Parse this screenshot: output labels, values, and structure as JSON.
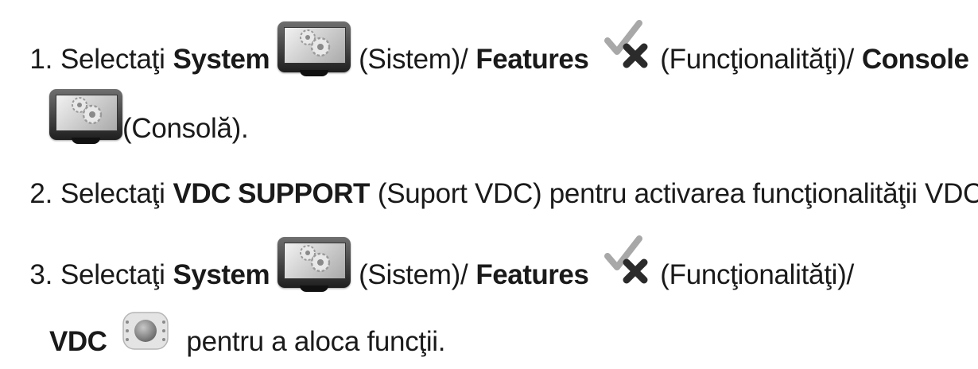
{
  "steps": [
    {
      "number": "1.",
      "select": "Selectaţi",
      "system": "System",
      "system_ro": "(Sistem)/",
      "features": "Features",
      "features_ro": "(Funcţionalităţi)/",
      "console": "Console",
      "console_ro": "(Consolă)."
    },
    {
      "number": "2.",
      "select": "Selectaţi",
      "vdc_support": "VDC SUPPORT",
      "rest": "(Suport VDC) pentru activarea funcţionalităţii VDC."
    },
    {
      "number": "3.",
      "select": "Selectaţi",
      "system": "System",
      "system_ro": "(Sistem)/",
      "features": "Features",
      "features_ro": "(Funcţionalităţi)/",
      "vdc": "VDC",
      "rest": "pentru a aloca funcţii."
    }
  ],
  "icons": {
    "system": "console-settings-icon",
    "features": "check-cross-icon",
    "console": "console-settings-icon",
    "vdc": "vdc-dial-icon"
  },
  "colors": {
    "text": "#1a1a1a",
    "check": "#9a9a9a",
    "cross": "#2b2b2b"
  }
}
